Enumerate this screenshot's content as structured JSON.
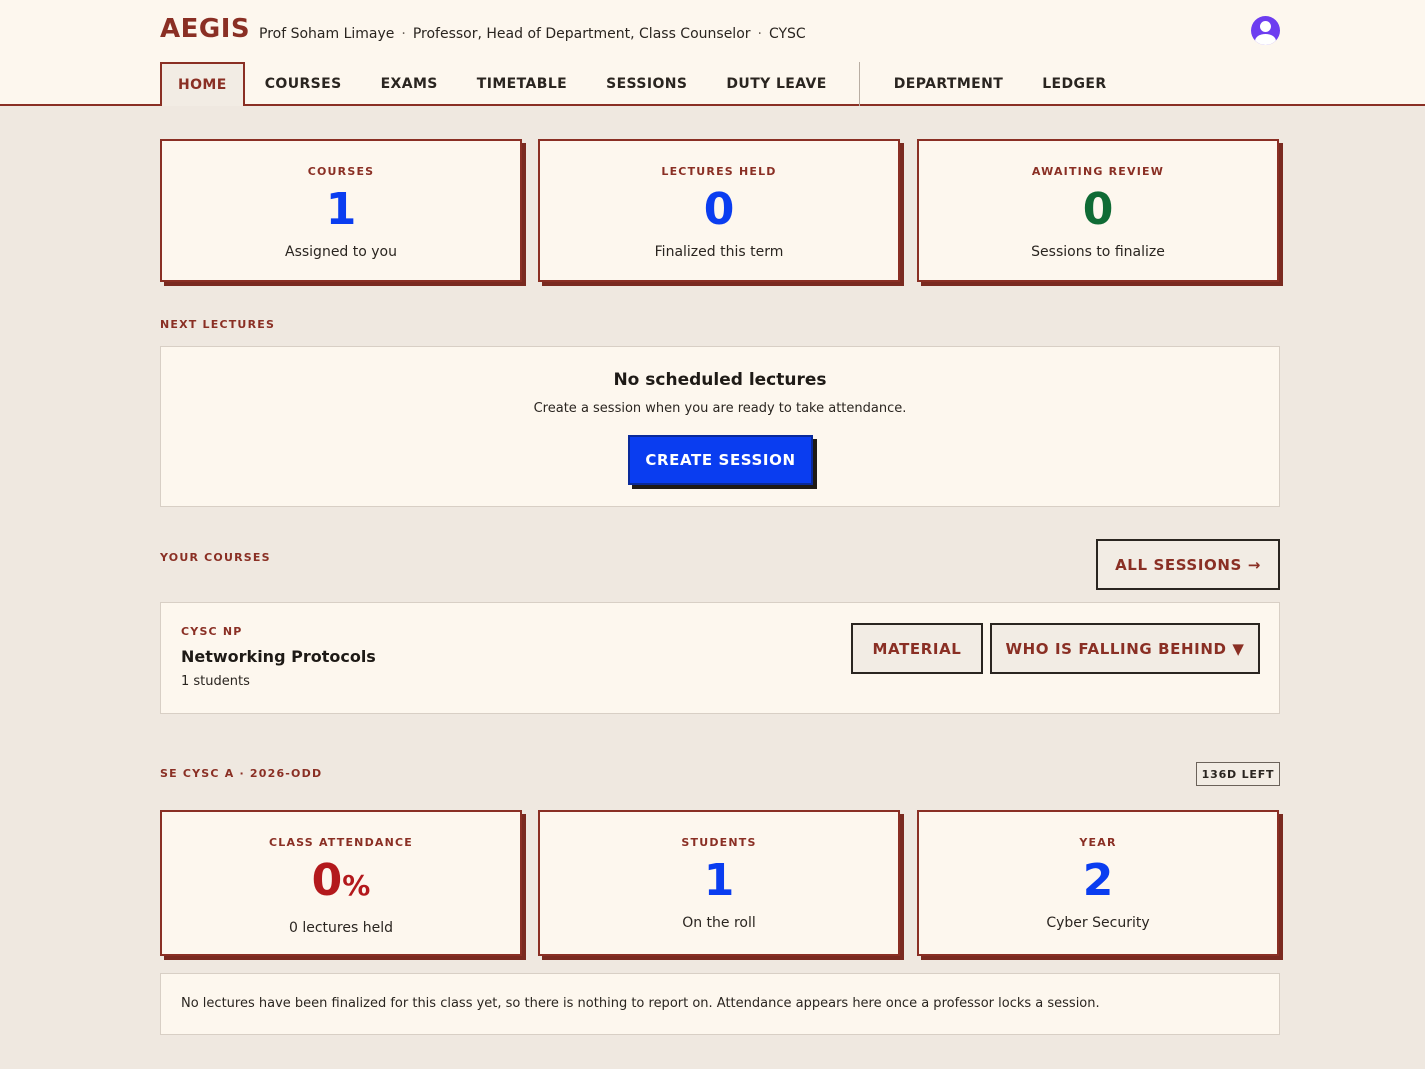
{
  "header": {
    "logo": "AEGIS",
    "user_name": "Prof Soham Limaye",
    "user_roles": "Professor, Head of Department, Class Counselor",
    "user_dept": "CYSC",
    "separator": "·",
    "avatar_icon": "user-avatar-icon"
  },
  "nav": {
    "items": [
      "HOME",
      "COURSES",
      "EXAMS",
      "TIMETABLE",
      "SESSIONS",
      "DUTY LEAVE"
    ],
    "secondary": [
      "DEPARTMENT",
      "LEDGER"
    ],
    "active": "HOME"
  },
  "stats": [
    {
      "label": "COURSES",
      "value": "1",
      "sub": "Assigned to you",
      "color": "#0a3df0"
    },
    {
      "label": "LECTURES HELD",
      "value": "0",
      "sub": "Finalized this term",
      "color": "#0a3df0"
    },
    {
      "label": "AWAITING REVIEW",
      "value": "0",
      "sub": "Sessions to finalize",
      "color": "#0f6b35"
    }
  ],
  "next_lectures": {
    "section_label": "NEXT LECTURES",
    "empty_title": "No scheduled lectures",
    "empty_desc": "Create a session when you are ready to take attendance.",
    "create_button": "CREATE SESSION"
  },
  "your_courses": {
    "section_label": "YOUR COURSES",
    "all_sessions_button": "ALL SESSIONS →",
    "courses": [
      {
        "code": "CYSC NP",
        "name": "Networking Protocols",
        "students": "1 students",
        "material_button": "MATERIAL",
        "falling_behind_button": "WHO IS FALLING BEHIND ▼"
      }
    ]
  },
  "class": {
    "section_label": "SE CYSC A · 2026-ODD",
    "badge": "136D LEFT",
    "stats": [
      {
        "label": "CLASS ATTENDANCE",
        "value": "0",
        "unit": "%",
        "sub": "0 lectures held",
        "color": "#b3191c"
      },
      {
        "label": "STUDENTS",
        "value": "1",
        "sub": "On the roll",
        "color": "#0a3df0"
      },
      {
        "label": "YEAR",
        "value": "2",
        "sub": "Cyber Security",
        "color": "#0a3df0"
      }
    ],
    "note": "No lectures have been finalized for this class yet, so there is nothing to report on. Attendance appears here once a professor locks a session."
  }
}
